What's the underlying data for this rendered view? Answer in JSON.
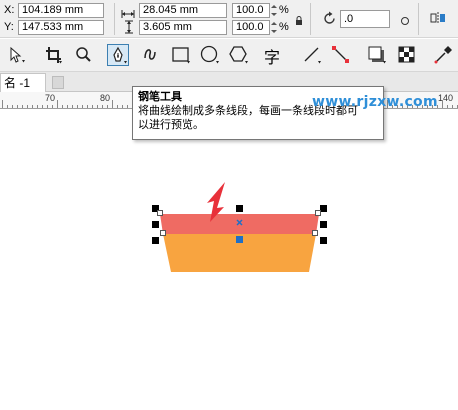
{
  "property_bar": {
    "x_label": "X:",
    "x_value": "104.189 mm",
    "y_label": "Y:",
    "y_value": "147.533 mm",
    "width_value": "28.045 mm",
    "height_value": "3.605 mm",
    "scale_x": "100.0",
    "scale_y": "100.0",
    "percent_x": "%",
    "percent_y": "%",
    "rotation_value": ".0"
  },
  "toolbox": {
    "active_tool": "pen-tool",
    "text_tool_glyph": "字"
  },
  "document_tab": {
    "label": "名 -1"
  },
  "ruler": {
    "labels": [
      "70",
      "80",
      "140"
    ]
  },
  "tooltip": {
    "title": "钢笔工具",
    "line1": "将曲线绘制成多条线段，每画一条线段时都可",
    "line2": "以进行预览。"
  },
  "watermark": {
    "text": "www.rjzxw.com"
  },
  "shape": {
    "top_color": "#ef6b63",
    "bottom_color": "#f8a440",
    "arrow_color": "#e8313a",
    "center_marker_color": "#1f6fc7"
  }
}
